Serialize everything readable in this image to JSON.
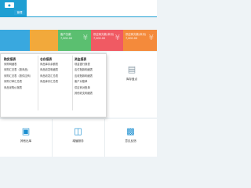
{
  "header": {
    "logo_text": "管理",
    "nav_label": "管理"
  },
  "cards": [
    {
      "title": "",
      "value": ""
    },
    {
      "title": "",
      "value": ""
    },
    {
      "title": "客户欠款",
      "value": "7,000.00"
    },
    {
      "title": "供应商欠款(本月)",
      "value": "7,000.00"
    },
    {
      "title": "供应商欠款(本月)",
      "value": "7,000.00"
    }
  ],
  "dropdown": {
    "columns": [
      {
        "title": "购货报表",
        "items": [
          "采购明细表",
          "采购汇总表（按商品）",
          "采购汇总表（按供应商）",
          "采购订单汇总表",
          "商品采购价报表"
        ]
      },
      {
        "title": "仓存报表",
        "items": [
          "商品库存余额表",
          "商品收发明细表",
          "商品收发汇总表",
          "商品库存汇总表"
        ]
      },
      {
        "title": "资金报表",
        "items": [
          "现金银行报表",
          "应付账款明细表",
          "应收账款明细表",
          "客户对账单",
          "供应商对账单",
          "其他收支明细表"
        ]
      }
    ]
  },
  "tiles": {
    "stock_check": "库存盘点",
    "other_out": "其他出库",
    "value_added": "增值服务",
    "feedback": "意见反馈"
  },
  "colors": {
    "primary": "#1e9fd3",
    "card_blue": "#39a8df",
    "card_orange": "#f2a93b",
    "card_green": "#5bbf70",
    "card_red": "#f05a63",
    "card_orange2": "#f48a3b"
  }
}
